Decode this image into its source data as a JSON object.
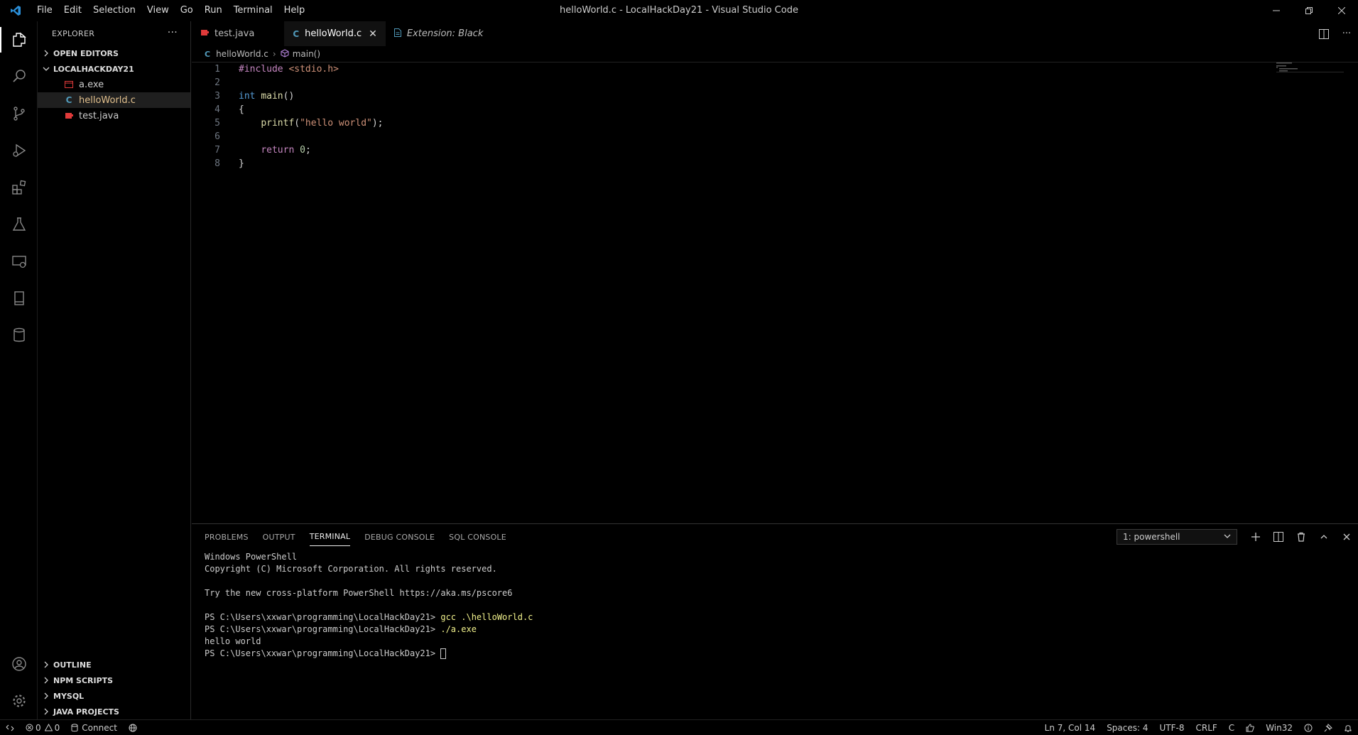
{
  "titlebar": {
    "menu": [
      "File",
      "Edit",
      "Selection",
      "View",
      "Go",
      "Run",
      "Terminal",
      "Help"
    ],
    "title": "helloWorld.c - LocalHackDay21 - Visual Studio Code"
  },
  "sidebar": {
    "header": "EXPLORER",
    "open_editors": "OPEN EDITORS",
    "folder": "LOCALHACKDAY21",
    "files": [
      {
        "name": "a.exe"
      },
      {
        "name": "helloWorld.c"
      },
      {
        "name": "test.java"
      }
    ],
    "bottom_sections": [
      "OUTLINE",
      "NPM SCRIPTS",
      "MYSQL",
      "JAVA PROJECTS"
    ]
  },
  "tabs": [
    {
      "label": "test.java"
    },
    {
      "label": "helloWorld.c"
    },
    {
      "label": "Extension: Black"
    }
  ],
  "breadcrumbs": {
    "file": "helloWorld.c",
    "symbol": "main()"
  },
  "editor": {
    "lines": [
      {
        "n": "1",
        "t": "#include <stdio.h>"
      },
      {
        "n": "2",
        "t": ""
      },
      {
        "n": "3",
        "t": "int main()"
      },
      {
        "n": "4",
        "t": "{"
      },
      {
        "n": "5",
        "t": "printf(\"hello world\");"
      },
      {
        "n": "6",
        "t": ""
      },
      {
        "n": "7",
        "t": "return 0;"
      },
      {
        "n": "8",
        "t": "}"
      }
    ]
  },
  "panel": {
    "tabs": [
      "PROBLEMS",
      "OUTPUT",
      "TERMINAL",
      "DEBUG CONSOLE",
      "SQL CONSOLE"
    ],
    "terminal_select": "1: powershell",
    "terminal": {
      "l1": "Windows PowerShell",
      "l2": "Copyright (C) Microsoft Corporation. All rights reserved.",
      "l4": "Try the new cross-platform PowerShell https://aka.ms/pscore6",
      "prompt": "PS C:\\Users\\xxwar\\programming\\LocalHackDay21> ",
      "cmd1": "gcc .\\helloWorld.c",
      "cmd2": "./a.exe",
      "out": "hello world"
    }
  },
  "statusbar": {
    "errors": "0",
    "warnings": "0",
    "connect": "Connect",
    "position": "Ln 7, Col 14",
    "spaces": "Spaces: 4",
    "encoding": "UTF-8",
    "eol": "CRLF",
    "lang": "C",
    "platform": "Win32"
  },
  "colors": {
    "c_icon": "#519aba",
    "java_icon": "#e03a3a",
    "exe_icon": "#e03a3a",
    "selected_file": "#e2c08d"
  }
}
